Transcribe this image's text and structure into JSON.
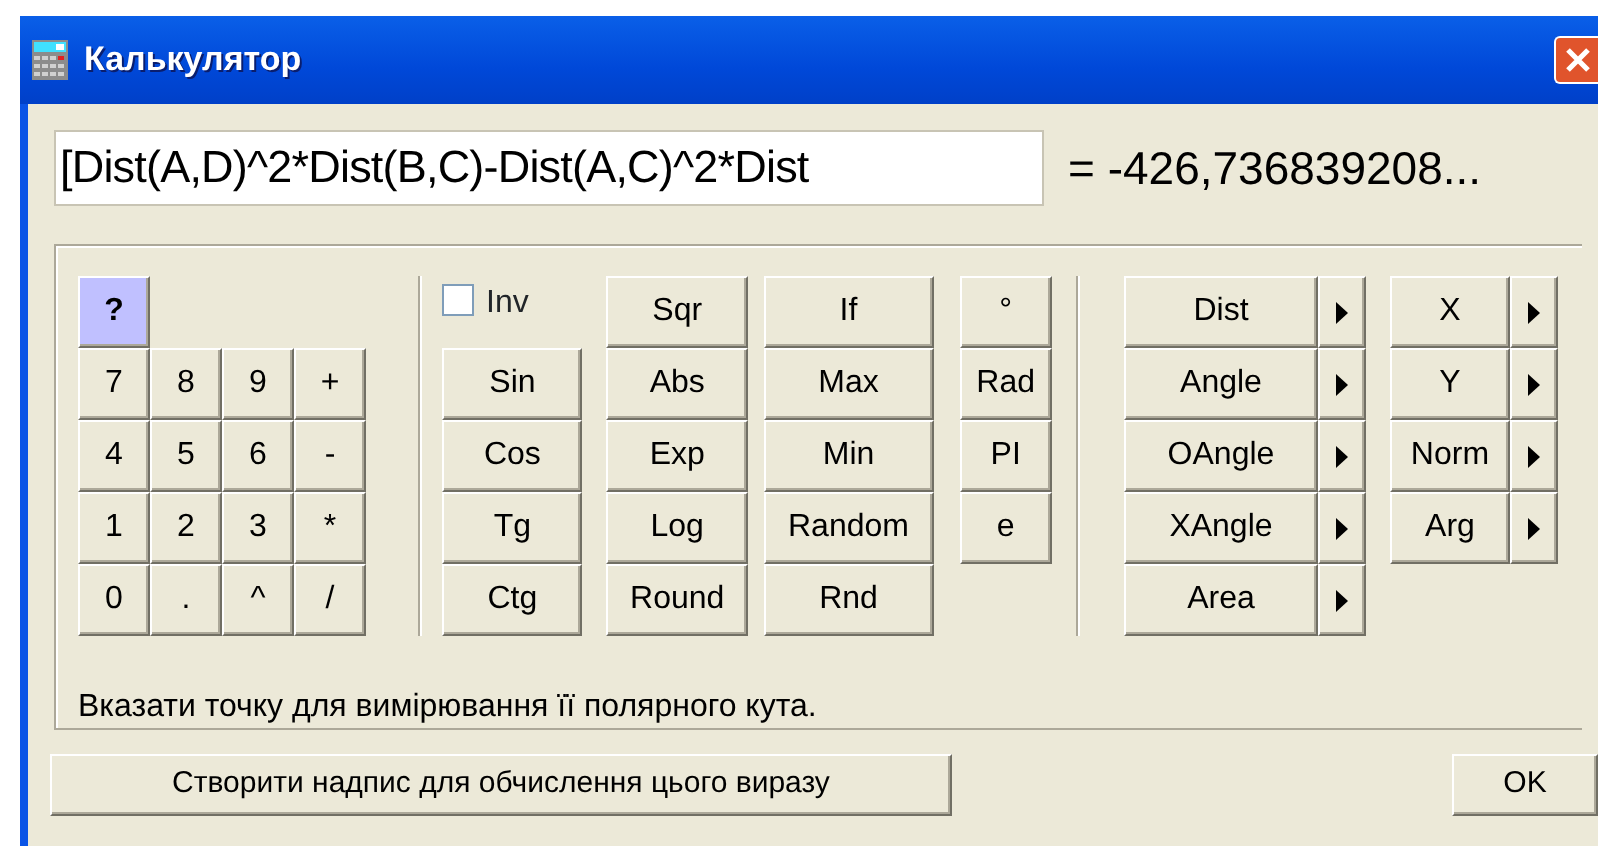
{
  "window": {
    "title": "Калькулятор"
  },
  "expression": {
    "value": "[Dist(A,D)^2*Dist(B,C)-Dist(A,C)^2*Dist"
  },
  "result": "= -426,736839208...",
  "help_key": {
    "label": "?",
    "active": true
  },
  "keypad": [
    [
      "7",
      "8",
      "9",
      "+"
    ],
    [
      "4",
      "5",
      "6",
      "-"
    ],
    [
      "1",
      "2",
      "3",
      "*"
    ],
    [
      "0",
      ".",
      "^",
      "/"
    ]
  ],
  "inverse": {
    "label": "Inv",
    "checked": false
  },
  "function_columns": [
    [
      "Sin",
      "Cos",
      "Tg",
      "Ctg"
    ],
    [
      "Sqr",
      "Abs",
      "Exp",
      "Log",
      "Round"
    ],
    [
      "If",
      "Max",
      "Min",
      "Random",
      "Rnd"
    ],
    [
      "°",
      "Rad",
      "PI",
      "e"
    ]
  ],
  "menu_columns": [
    [
      "Dist",
      "Angle",
      "OAngle",
      "XAngle",
      "Area"
    ],
    [
      "X",
      "Y",
      "Norm",
      "Arg"
    ]
  ],
  "hint": "Вказати точку для вимірювання її полярного кута.",
  "buttons": [
    {
      "label": "Створити надпис для обчислення цього виразу",
      "kind": "wide"
    },
    {
      "label": "OK",
      "kind": "default"
    }
  ]
}
